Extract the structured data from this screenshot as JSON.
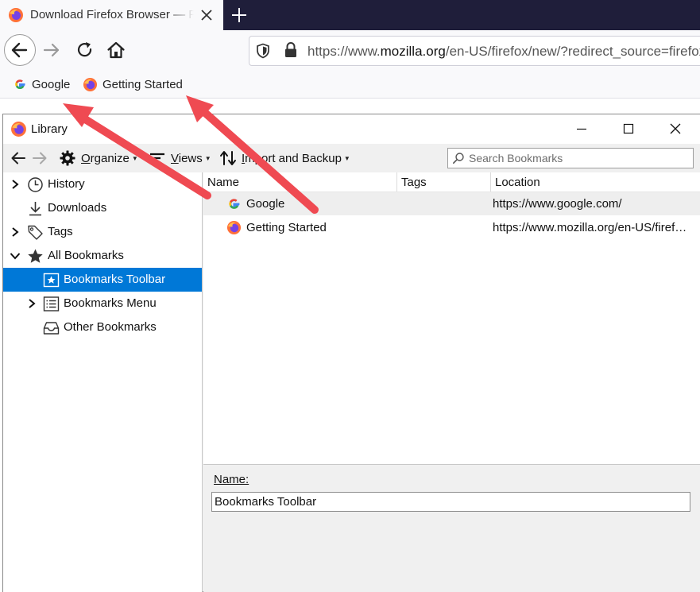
{
  "browser": {
    "tab": {
      "title": "Download Firefox Browser — Fast, Private & Free — from Mozilla"
    },
    "url": {
      "prefix": "https://www.",
      "domain": "mozilla.org",
      "path": "/en-US/firefox/new/?redirect_source=firefox"
    },
    "bookmarks_bar": [
      {
        "label": "Google",
        "icon": "google-icon"
      },
      {
        "label": "Getting Started",
        "icon": "firefox-icon"
      }
    ]
  },
  "library": {
    "title": "Library",
    "toolbar": {
      "organize": {
        "pre": "",
        "accel": "O",
        "post": "rganize"
      },
      "views": {
        "pre": "",
        "accel": "V",
        "post": "iews"
      },
      "import": {
        "pre": "",
        "accel": "I",
        "post": "mport and Backup"
      },
      "search_placeholder": "Search Bookmarks"
    },
    "tree": [
      {
        "label": "History",
        "icon": "clock-icon",
        "twisty": "collapsed",
        "level": 0
      },
      {
        "label": "Downloads",
        "icon": "download-icon",
        "twisty": "none",
        "level": 0
      },
      {
        "label": "Tags",
        "icon": "tag-icon",
        "twisty": "collapsed",
        "level": 0
      },
      {
        "label": "All Bookmarks",
        "icon": "star-icon",
        "twisty": "expanded",
        "level": 0
      },
      {
        "label": "Bookmarks Toolbar",
        "icon": "bookmarks-toolbar-icon",
        "twisty": "none",
        "level": 1,
        "selected": true
      },
      {
        "label": "Bookmarks Menu",
        "icon": "bookmarks-menu-icon",
        "twisty": "collapsed",
        "level": 1
      },
      {
        "label": "Other Bookmarks",
        "icon": "tray-icon",
        "twisty": "none",
        "level": 1
      }
    ],
    "columns": [
      "Name",
      "Tags",
      "Location"
    ],
    "rows": [
      {
        "name": "Google",
        "tags": "",
        "location": "https://www.google.com/",
        "icon": "google-icon"
      },
      {
        "name": "Getting Started",
        "tags": "",
        "location": "https://www.mozilla.org/en-US/firefox/central/",
        "icon": "firefox-icon"
      }
    ],
    "details": {
      "name_label": "Name:",
      "name_value": "Bookmarks Toolbar"
    }
  },
  "colors": {
    "selection": "#0078d7",
    "arrow": "#ef4a52",
    "tabstrip": "#1f1e3a"
  }
}
